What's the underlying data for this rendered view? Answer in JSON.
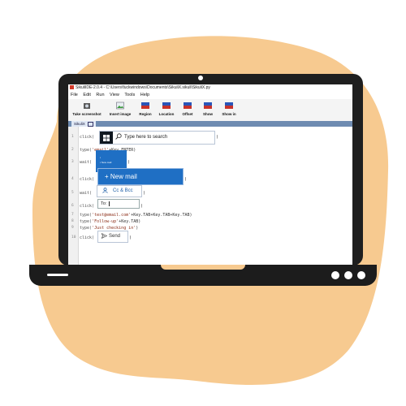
{
  "colors": {
    "blob": "#f7ca90",
    "laptop": "#1f1f1f",
    "accent": "#1f6fc4",
    "tab_strip": "#6e8bb1"
  },
  "window": {
    "title": "SikuliIDE-2.0.4 - C:\\Users\\fuckwindows\\Documents\\SikuliX.sikuli\\SikuliX.py"
  },
  "menu": [
    "File",
    "Edit",
    "Run",
    "View",
    "Tools",
    "Help"
  ],
  "toolbar": [
    {
      "label": "Take screenshot",
      "icon": "camera-icon"
    },
    {
      "label": "Insert image",
      "icon": "image-icon"
    },
    {
      "label": "Region",
      "icon": "region-icon"
    },
    {
      "label": "Location",
      "icon": "location-icon"
    },
    {
      "label": "Offset",
      "icon": "offset-icon"
    },
    {
      "label": "Show",
      "icon": "show-icon"
    },
    {
      "label": "Show in",
      "icon": "show-in-icon"
    }
  ],
  "tab": {
    "label": "SikuliX"
  },
  "code": {
    "line_numbers": [
      "1",
      "2",
      "3",
      "4",
      "5",
      "6",
      "7",
      "8",
      "9",
      "10"
    ],
    "l1": "click(",
    "l2_fn": "type(",
    "l2_str": "'email'",
    "l2_rest": "+Key.ENTER)",
    "l3": "wait(",
    "l4": "click(",
    "l5": "wait(",
    "l6": "click(",
    "l7_fn": "type(",
    "l7_str": "'test@email.com'",
    "l7_rest": "+Key.TAB+Key.TAB+Key.TAB)",
    "l8_fn": "type(",
    "l8_str": "'Follow-up'",
    "l8_rest": "+Key.TAB)",
    "l9_fn": "type(",
    "l9_str": "'Just checking in'",
    "l9_rest": ")",
    "l10": "click("
  },
  "patterns": {
    "search_text": "Type here to search",
    "thumb3_line1": "▪",
    "thumb3_line2": "▪ New mail",
    "new_mail": "+ New mail",
    "cc_bcc": "Cc & Bcc",
    "to": "To:",
    "send": "Send"
  }
}
